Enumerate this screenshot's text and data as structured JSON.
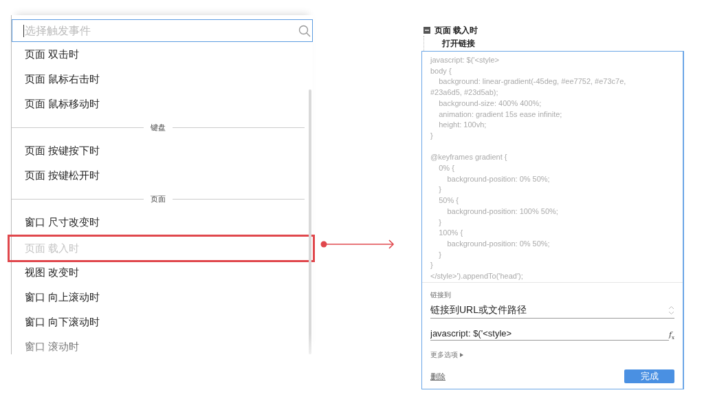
{
  "event_picker": {
    "search": {
      "placeholder": "选择触发事件"
    },
    "items": [
      {
        "kind": "item",
        "label": "页面 双击时",
        "disabled": false,
        "highlighted": false
      },
      {
        "kind": "item",
        "label": "页面 鼠标右击时",
        "disabled": false,
        "highlighted": false
      },
      {
        "kind": "item",
        "label": "页面 鼠标移动时",
        "disabled": false,
        "highlighted": false
      },
      {
        "kind": "divider",
        "label": "键盘"
      },
      {
        "kind": "item",
        "label": "页面 按键按下时",
        "disabled": false,
        "highlighted": false
      },
      {
        "kind": "item",
        "label": "页面 按键松开时",
        "disabled": false,
        "highlighted": false
      },
      {
        "kind": "divider",
        "label": "页面"
      },
      {
        "kind": "item",
        "label": "窗口 尺寸改变时",
        "disabled": false,
        "highlighted": false
      },
      {
        "kind": "item",
        "label": "页面 载入时",
        "disabled": true,
        "highlighted": true
      },
      {
        "kind": "item",
        "label": "视图 改变时",
        "disabled": false,
        "highlighted": false
      },
      {
        "kind": "item",
        "label": "窗口 向上滚动时",
        "disabled": false,
        "highlighted": false
      },
      {
        "kind": "item",
        "label": "窗口 向下滚动时",
        "disabled": false,
        "highlighted": false
      },
      {
        "kind": "item",
        "label": "窗口 滚动时",
        "disabled": false,
        "highlighted": false
      }
    ]
  },
  "action_editor": {
    "event": {
      "label": "页面 载入时",
      "expanded": true
    },
    "action": {
      "label": "打开链接"
    },
    "code_blocks": [
      [
        "javascript: $('<style>",
        "body {",
        "    background: linear-gradient(-45deg, #ee7752, #e73c7e,",
        "#23a6d5, #23d5ab);",
        "    background-size: 400% 400%;",
        "    animation: gradient 15s ease infinite;",
        "    height: 100vh;",
        "}"
      ],
      [
        "@keyframes gradient {",
        "    0% {",
        "        background-position: 0% 50%;",
        "    }",
        "    50% {",
        "        background-position: 100% 50%;",
        "    }",
        "    100% {",
        "        background-position: 0% 50%;",
        "    }",
        "}",
        "</style>').appendTo('head');"
      ]
    ],
    "link_label": "链接到",
    "link_select": {
      "value": "链接到URL或文件路径"
    },
    "url_field": {
      "value": "javascript: $('<style>"
    },
    "function_button": "*f*$_{x}$",
    "more_options": "更多选项",
    "delete_link": "删除",
    "done_button": "完成"
  }
}
